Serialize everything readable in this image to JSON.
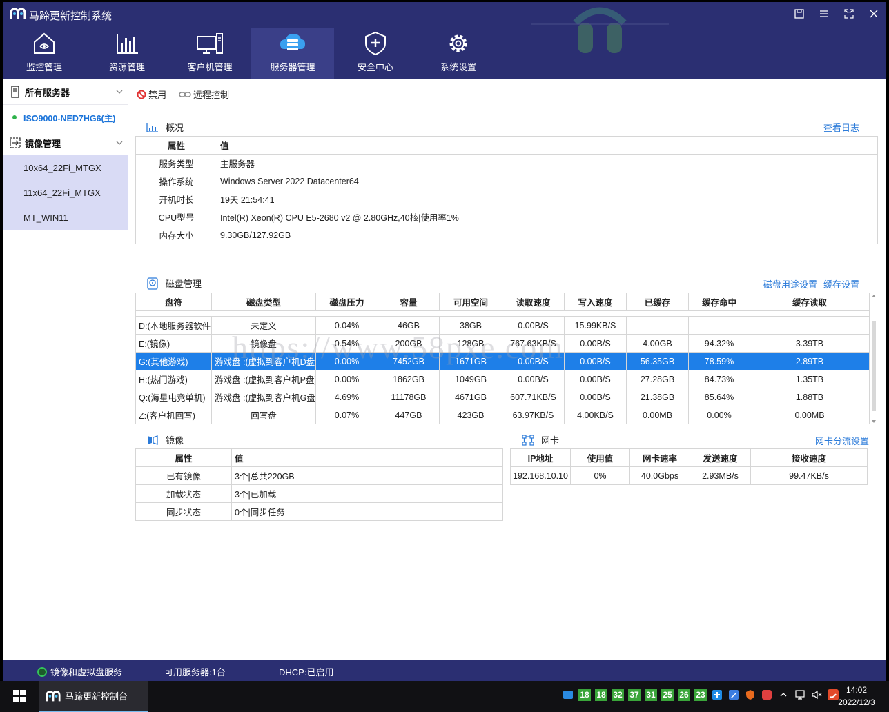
{
  "app": {
    "title": "马蹄更新控制系统"
  },
  "nav": [
    {
      "label": "监控管理",
      "icon": "home-monitor-icon"
    },
    {
      "label": "资源管理",
      "icon": "bar-chart-icon"
    },
    {
      "label": "客户机管理",
      "icon": "monitors-icon"
    },
    {
      "label": "服务器管理",
      "icon": "cloud-server-icon",
      "active": true
    },
    {
      "label": "安全中心",
      "icon": "shield-plus-icon"
    },
    {
      "label": "系统设置",
      "icon": "gear-icon"
    }
  ],
  "sidebar": {
    "all_servers": "所有服务器",
    "server": "ISO9000-NED7HG6(主)",
    "image_mgmt": "镜像管理",
    "images": [
      "10x64_22Fi_MTGX",
      "11x64_22Fi_MTGX",
      "MT_WIN11"
    ]
  },
  "toolbar": {
    "disable": "禁用",
    "remote": "远程控制"
  },
  "overview": {
    "title": "概况",
    "view_log": "查看日志",
    "header": [
      "属性",
      "值"
    ],
    "rows": [
      [
        "服务类型",
        "主服务器"
      ],
      [
        "操作系统",
        "Windows Server 2022 Datacenter64"
      ],
      [
        "开机时长",
        "19天 21:54:41"
      ],
      [
        "CPU型号",
        "Intel(R) Xeon(R) CPU E5-2680 v2 @ 2.80GHz,40核|使用率1%"
      ],
      [
        "内存大小",
        "9.30GB/127.92GB"
      ]
    ]
  },
  "disk": {
    "title": "磁盘管理",
    "link_usage": "磁盘用途设置",
    "link_cache": "缓存设置",
    "header": [
      "盘符",
      "磁盘类型",
      "磁盘压力",
      "容量",
      "可用空间",
      "读取速度",
      "写入速度",
      "已缓存",
      "缓存命中",
      "缓存读取"
    ],
    "rows": [
      [
        "D:(本地服务器软件)",
        "未定义",
        "0.04%",
        "46GB",
        "38GB",
        "0.00B/S",
        "15.99KB/S",
        "",
        "",
        ""
      ],
      [
        "E:(镜像)",
        "镜像盘",
        "0.54%",
        "200GB",
        "128GB",
        "767.63KB/S",
        "0.00B/S",
        "4.00GB",
        "94.32%",
        "3.39TB"
      ],
      [
        "G:(其他游戏)",
        "游戏盘 :(虚拟到客户机D盘)",
        "0.00%",
        "7452GB",
        "1671GB",
        "0.00B/S",
        "0.00B/S",
        "56.35GB",
        "78.59%",
        "2.89TB"
      ],
      [
        "H:(热门游戏)",
        "游戏盘 :(虚拟到客户机P盘)",
        "0.00%",
        "1862GB",
        "1049GB",
        "0.00B/S",
        "0.00B/S",
        "27.28GB",
        "84.73%",
        "1.35TB"
      ],
      [
        "Q:(海星电竞单机)",
        "游戏盘 :(虚拟到客户机G盘)",
        "4.69%",
        "11178GB",
        "4671GB",
        "607.71KB/S",
        "0.00B/S",
        "21.38GB",
        "85.64%",
        "1.88TB"
      ],
      [
        "Z:(客户机回写)",
        "回写盘",
        "0.07%",
        "447GB",
        "423GB",
        "63.97KB/S",
        "4.00KB/S",
        "0.00MB",
        "0.00%",
        "0.00MB"
      ]
    ],
    "selected_row": 2
  },
  "watermark": "https://www.58pxe.com",
  "mirror": {
    "title": "镜像",
    "header": [
      "属性",
      "值"
    ],
    "rows": [
      [
        "已有镜像",
        "3个|总共220GB"
      ],
      [
        "加载状态",
        "3个|已加载"
      ],
      [
        "同步状态",
        "0个|同步任务"
      ]
    ]
  },
  "nic": {
    "title": "网卡",
    "link": "网卡分流设置",
    "header": [
      "IP地址",
      "使用值",
      "网卡速率",
      "发送速度",
      "接收速度"
    ],
    "rows": [
      [
        "192.168.10.10",
        "0%",
        "40.0Gbps",
        "2.93MB/s",
        "99.47KB/s"
      ]
    ]
  },
  "status": {
    "service": "镜像和虚拟盘服务",
    "servers": "可用服务器:1台",
    "dhcp": "DHCP:已启用"
  },
  "taskbar": {
    "task_label": "马蹄更新控制台",
    "tray_numbers": [
      "18",
      "18",
      "32",
      "37",
      "31",
      "25",
      "26",
      "23"
    ],
    "time": "14:02",
    "date": "2022/12/3"
  }
}
